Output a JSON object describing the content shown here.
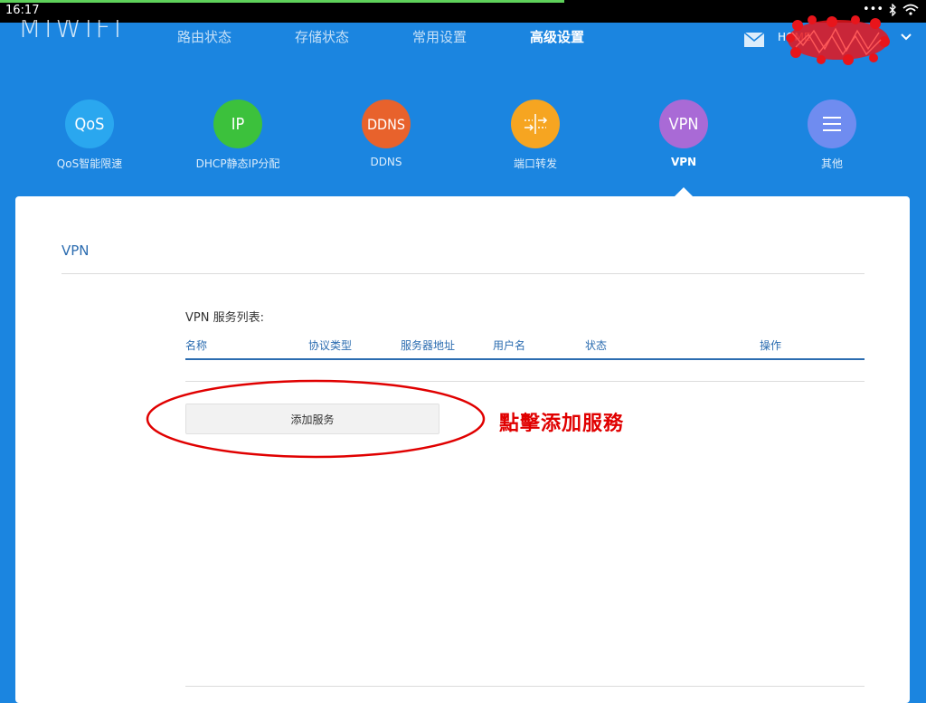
{
  "status_bar": {
    "time": "16:17"
  },
  "header": {
    "logo": "MIWIFI",
    "nav": [
      {
        "label": "路由状态",
        "active": false
      },
      {
        "label": "存储状态",
        "active": false
      },
      {
        "label": "常用设置",
        "active": false
      },
      {
        "label": "高级设置",
        "active": true
      }
    ],
    "user_prefix": "HOME"
  },
  "features": [
    {
      "id": "qos",
      "glyph": "QoS",
      "label": "QoS智能限速",
      "color": "#2aa7ef",
      "active": false
    },
    {
      "id": "ip",
      "glyph": "IP",
      "label": "DHCP静态IP分配",
      "color": "#3cc13c",
      "active": false
    },
    {
      "id": "ddns",
      "glyph": "DDNS",
      "label": "DDNS",
      "color": "#e8622c",
      "active": false
    },
    {
      "id": "port",
      "glyph": "",
      "label": "端口转发",
      "color": "#f6a521",
      "active": false
    },
    {
      "id": "vpn",
      "glyph": "VPN",
      "label": "VPN",
      "color": "#a96ad6",
      "active": true
    },
    {
      "id": "other",
      "glyph": "",
      "label": "其他",
      "color": "#6f8cf0",
      "active": false
    }
  ],
  "vpn": {
    "section_title": "VPN",
    "list_label": "VPN 服务列表:",
    "columns": [
      "名称",
      "协议类型",
      "服务器地址",
      "用户名",
      "状态",
      "操作"
    ],
    "add_button": "添加服务"
  },
  "annotation": "點擊添加服務",
  "colors": {
    "background": "#1b85e0",
    "accent": "#2b6cb0",
    "annotation": "#e00000"
  }
}
